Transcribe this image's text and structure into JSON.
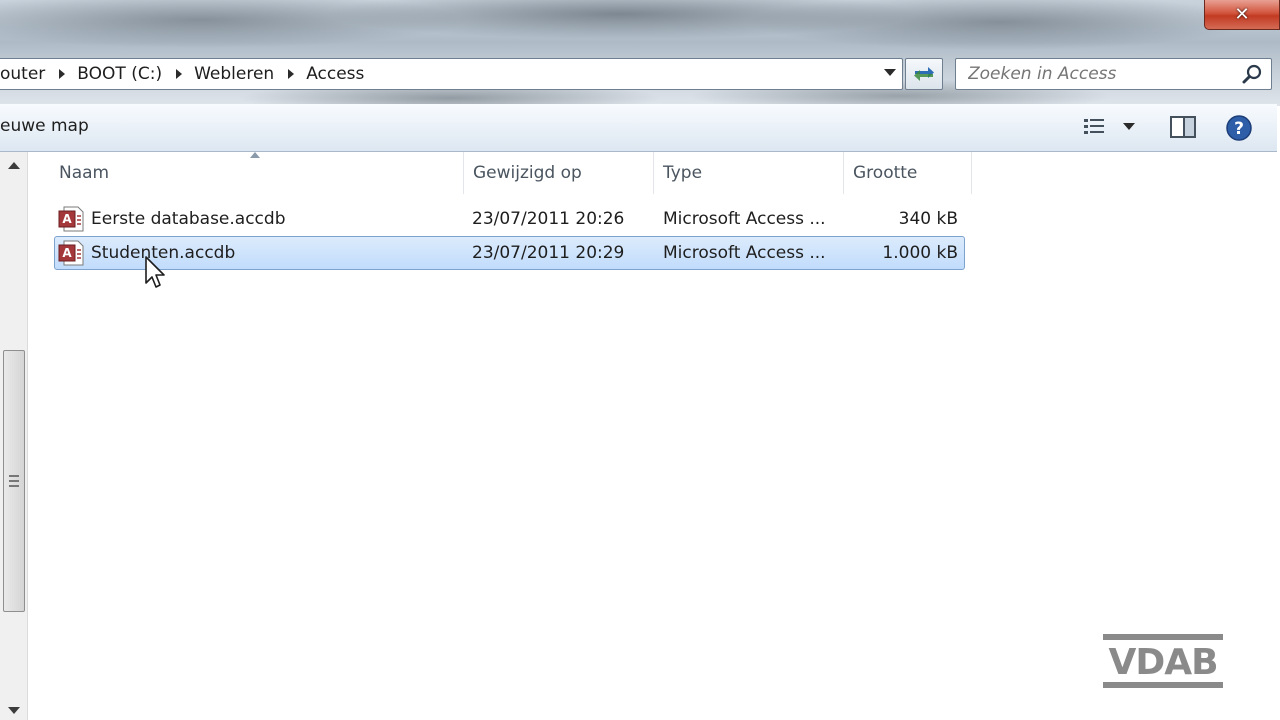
{
  "window": {
    "close_label": "✕"
  },
  "address": {
    "crumbs": [
      "outer",
      "BOOT (C:)",
      "Webleren",
      "Access"
    ]
  },
  "search": {
    "placeholder": "Zoeken in Access"
  },
  "toolbar": {
    "new_folder_label": "euwe map"
  },
  "columns": {
    "name": "Naam",
    "modified": "Gewijzigd op",
    "type": "Type",
    "size": "Grootte"
  },
  "files": [
    {
      "name": "Eerste database.accdb",
      "modified": "23/07/2011 20:26",
      "type": "Microsoft Access ...",
      "size": "340 kB",
      "selected": false
    },
    {
      "name": "Studenten.accdb",
      "modified": "23/07/2011 20:29",
      "type": "Microsoft Access ...",
      "size": "1.000 kB",
      "selected": true
    }
  ],
  "watermark": {
    "text": "VDAB"
  },
  "colors": {
    "selection": "#c1dcfc",
    "selection_border": "#7da2ce",
    "access_icon": "#a4373a",
    "close_button": "#c23a22"
  },
  "icons": {
    "file": "access-file-icon",
    "search": "search-icon",
    "refresh": "refresh-icon",
    "views": "view-details-icon",
    "preview": "preview-pane-icon",
    "help": "help-icon"
  }
}
